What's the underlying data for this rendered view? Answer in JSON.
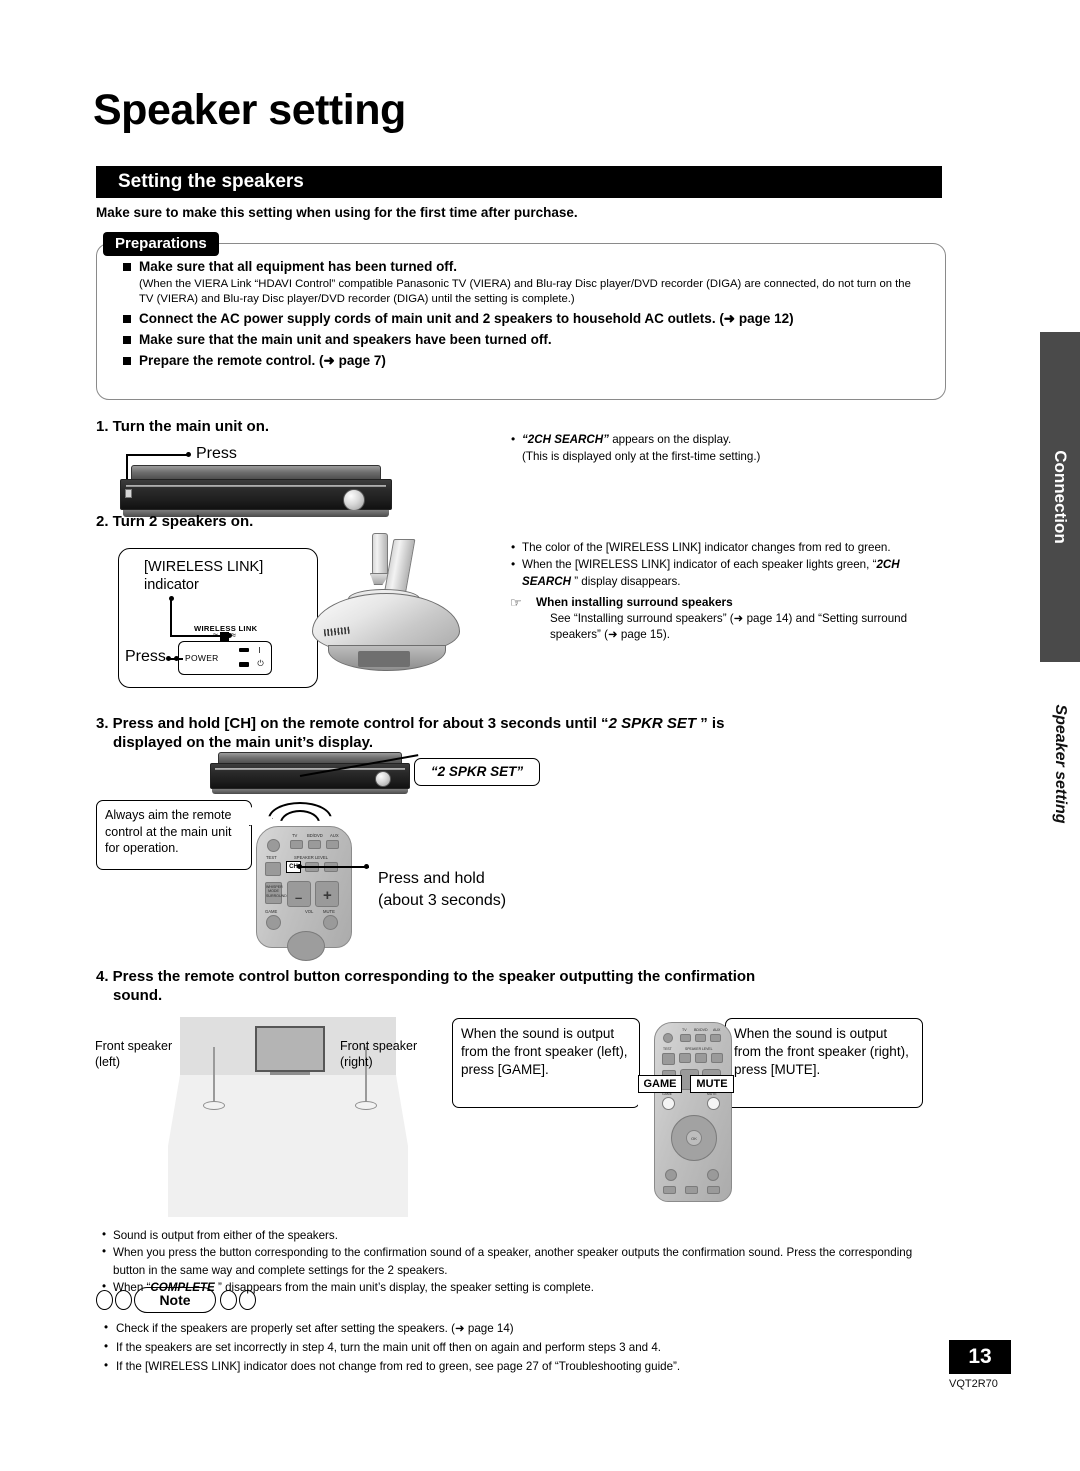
{
  "document": {
    "title": "Speaker setting",
    "section_header": "Setting the speakers",
    "intro": "Make sure to make this setting when using for the first time after purchase.",
    "page_number": "13",
    "model_code": "VQT2R70"
  },
  "side_tabs": {
    "primary": "Connection",
    "secondary": "Speaker setting"
  },
  "preparations": {
    "tag": "Preparations",
    "items": [
      {
        "head": "Make sure that all equipment has been turned off.",
        "sub": "(When the VIERA Link “HDAVI Control” compatible Panasonic TV (VIERA) and Blu-ray Disc player/DVD recorder (DIGA) are connected, do not turn on the TV (VIERA) and Blu-ray Disc player/DVD recorder (DIGA) until the setting is complete.)"
      },
      {
        "head": "Connect the AC power supply cords of main unit and 2 speakers to household AC outlets. (➜ page 12)",
        "sub": ""
      },
      {
        "head": "Make sure that the main unit and speakers have been turned off.",
        "sub": ""
      },
      {
        "head": "Prepare the remote control. (➜ page 7)",
        "sub": ""
      }
    ]
  },
  "steps": {
    "step1": {
      "title": "1. Turn the main unit on.",
      "press_label": "Press",
      "notes": [
        "“2CH SEARCH” appears on the display.",
        "(This is displayed only at the first-time setting.)"
      ],
      "note_quoted": "2CH SEARCH"
    },
    "step2": {
      "title": "2. Turn 2 speakers on.",
      "indicator_label_line1": "[WIRELESS LINK]",
      "indicator_label_line2": "indicator",
      "press_label": "Press",
      "panel_wireless": "WIRELESS LINK",
      "panel_power": "POWER",
      "notes": [
        "The color of the [WIRELESS LINK] indicator changes from red to green.",
        "When the [WIRELESS LINK] indicator of each speaker lights green, “2CH SEARCH ” display disappears."
      ],
      "hand_title": "When installing surround speakers",
      "hand_text": "See “Installing surround speakers” (➜ page 14) and “Setting surround speakers” (➜ page 15)."
    },
    "step3": {
      "title_line1": "3. Press and hold [CH] on the remote control for about 3 seconds until “2 SPKR SET ” is",
      "title_line2": "displayed on the main unit’s display.",
      "display_callout": "“2 SPKR SET”",
      "aim_note": "Always aim the remote control at the main unit for operation.",
      "press_hold_line1": "Press and hold",
      "press_hold_line2": "(about 3 seconds)",
      "key_ch": "CH"
    },
    "step4": {
      "title_line1": "4. Press the remote control button corresponding to the speaker outputting the confirmation",
      "title_line2": "sound.",
      "speaker_left_line1": "Front speaker",
      "speaker_left_line2": "(left)",
      "speaker_right_line1": "Front speaker",
      "speaker_right_line2": "(right)",
      "bubble_left": "When the sound is output from the front speaker (left), press [GAME].",
      "bubble_right": "When the sound is output from the front speaker (right), press [MUTE].",
      "key_game": "GAME",
      "key_mute": "MUTE",
      "notes": [
        "Sound is output from either of the speakers.",
        "When you press the button corresponding to the confirmation sound of a speaker, another speaker outputs the confirmation sound. Press the corresponding button in the same way and complete settings for the 2 speakers.",
        "When “COMPLETE ” disappears from the main unit’s display, the speaker setting is complete."
      ]
    }
  },
  "note_section": {
    "label": "Note",
    "items": [
      "Check if the speakers are properly set after setting the speakers. (➜ page 14)",
      "If the speakers are set incorrectly in step 4, turn the main unit off then on again and perform steps 3 and 4.",
      "If the [WIRELESS LINK] indicator does not change from red to green, see page 27 of “Troubleshooting guide”."
    ]
  },
  "remote_labels": {
    "power": "⏻",
    "tv": "TV",
    "bddvd": "BD/DVD",
    "aux": "AUX",
    "test": "TEST",
    "speaker_level": "SPEAKER LEVEL",
    "ch": "CH",
    "minus": "–",
    "plus": "+",
    "whisper": "WHISPER MODE SURROUND",
    "vol": "VOL",
    "game": "GAME",
    "mute": "MUTE",
    "ok": "OK"
  },
  "colors": {
    "header_bar": "#000000",
    "side_tab": "#4a4a4a",
    "page_badge": "#000000",
    "prep_border": "#8a8a8a"
  }
}
